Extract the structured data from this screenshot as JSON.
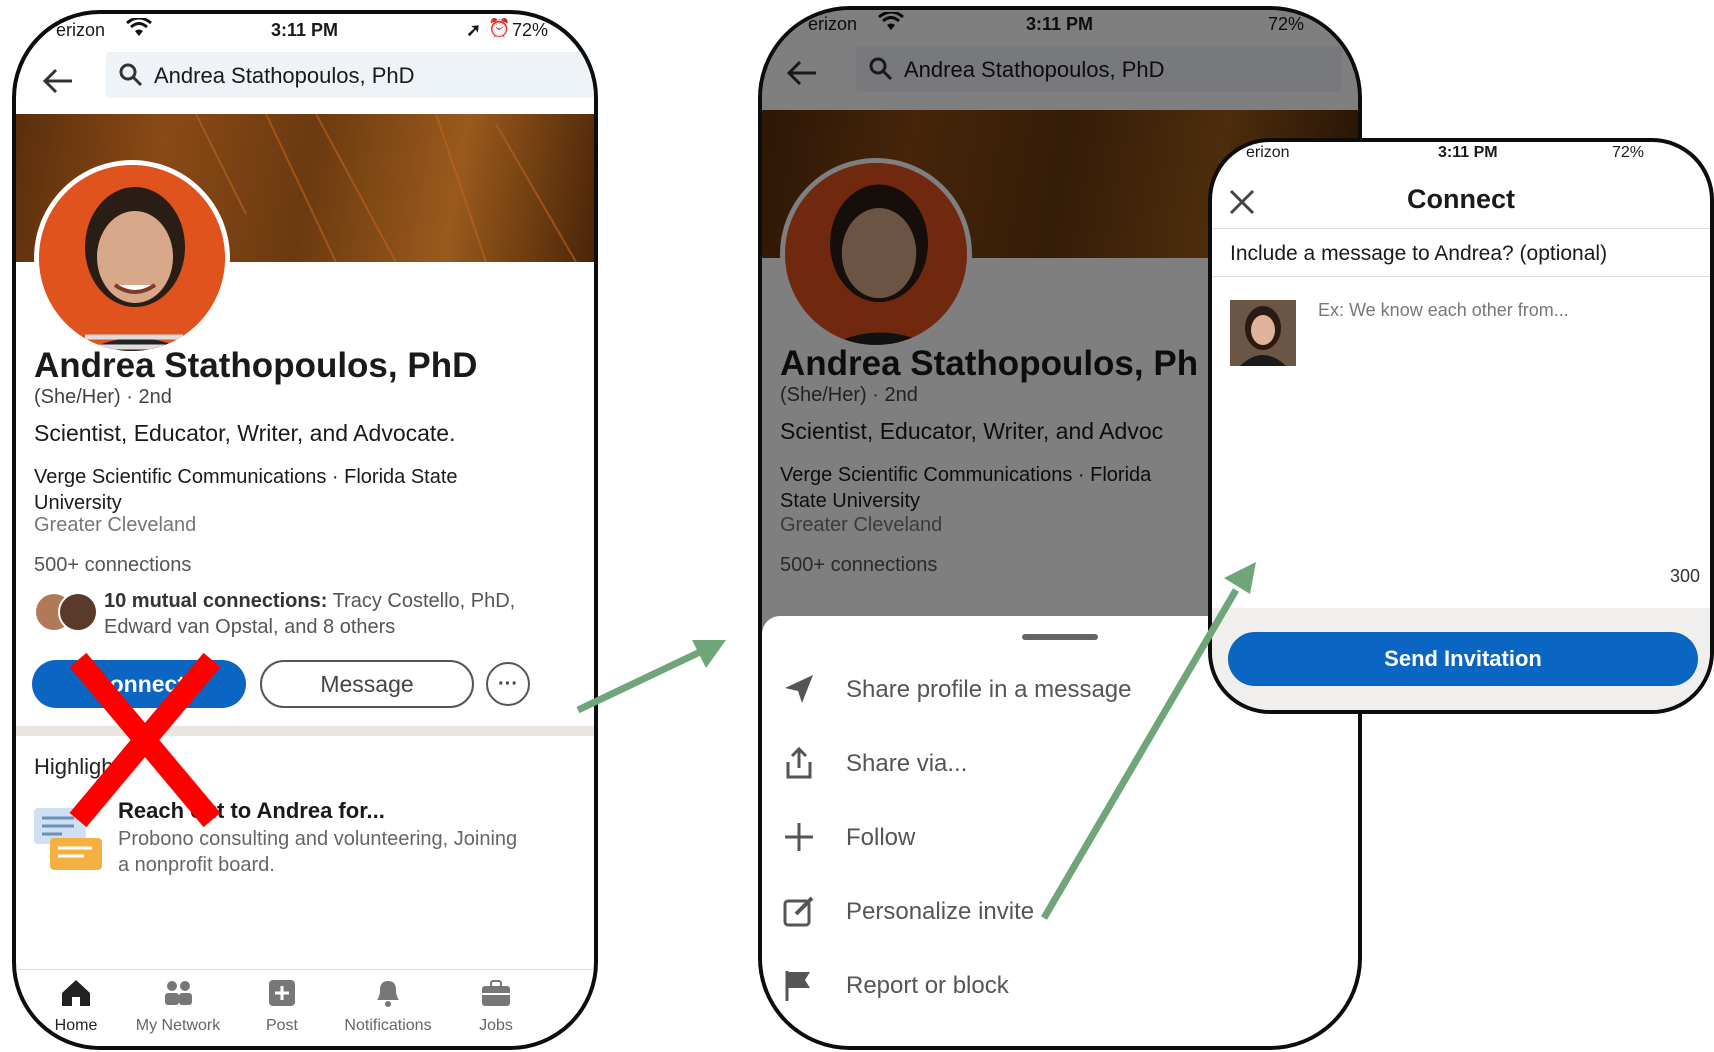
{
  "status": {
    "carrier": "erizon",
    "time": "3:11 PM",
    "battery": "72%"
  },
  "search": {
    "query": "Andrea Stathopoulos, PhD"
  },
  "profile": {
    "name": "Andrea Stathopoulos, PhD",
    "name_cut": "Andrea Stathopoulos, Ph",
    "pronouns_degree": "(She/Her) · 2nd",
    "headline": "Scientist, Educator, Writer, and Advocate.",
    "headline_cut": "Scientist, Educator, Writer, and Advoc",
    "company": "Verge Scientific Communications · Florida State University",
    "company_line1": "Verge Scientific Communications · Florida",
    "company_line2": "State University",
    "location": "Greater Cleveland",
    "connections": "500+ connections",
    "mutual_bold": "10 mutual connections:",
    "mutual_rest": " Tracy Costello, PhD, Edward van Opstal, and 8 others",
    "connect_label": "Connect",
    "message_label": "Message",
    "more_label": "···"
  },
  "highlights": {
    "title": "Highlights",
    "item_title": "Reach out to Andrea for...",
    "item_sub": "Probono consulting and volunteering, Joining a nonprofit board."
  },
  "bottom_nav": [
    {
      "label": "Home",
      "icon": "home-icon"
    },
    {
      "label": "My Network",
      "icon": "network-icon"
    },
    {
      "label": "Post",
      "icon": "post-icon"
    },
    {
      "label": "Notifications",
      "icon": "bell-icon"
    },
    {
      "label": "Jobs",
      "icon": "briefcase-icon"
    }
  ],
  "sheet": {
    "items": [
      {
        "label": "Share profile in a message",
        "icon": "send-icon"
      },
      {
        "label": "Share via...",
        "icon": "share-icon"
      },
      {
        "label": "Follow",
        "icon": "plus-icon"
      },
      {
        "label": "Personalize invite",
        "icon": "edit-icon"
      },
      {
        "label": "Report or block",
        "icon": "flag-icon"
      }
    ]
  },
  "connect_dialog": {
    "title": "Connect",
    "question": "Include a message to Andrea? (optional)",
    "placeholder": "Ex: We know each other from...",
    "char_count": "300",
    "send_label": "Send Invitation"
  },
  "colors": {
    "linkedin_blue": "#0a66c2",
    "annotation_arrow": "#6fa579",
    "annotation_x": "#ff0000"
  }
}
